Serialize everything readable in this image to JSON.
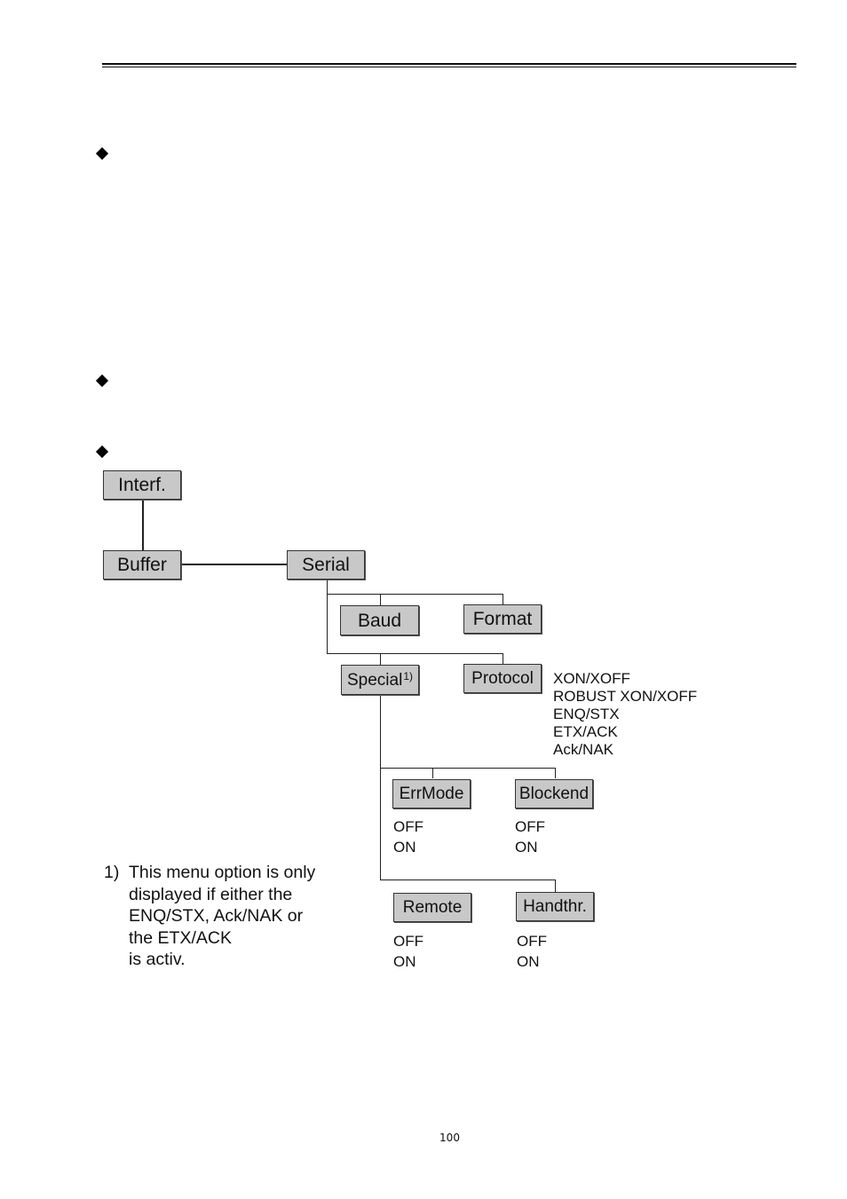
{
  "page": {
    "page_number": "100"
  },
  "diagram": {
    "nodes": {
      "interf": "Interf.",
      "buffer": "Buffer",
      "serial": "Serial",
      "baud": "Baud",
      "format": "Format",
      "special": "Special",
      "special_footnote_mark": "1)",
      "protocol": "Protocol",
      "errmode": "ErrMode",
      "blockend": "Blockend",
      "remote": "Remote",
      "handthr": "Handthr."
    },
    "protocol_options": [
      "XON/XOFF",
      "ROBUST XON/XOFF",
      "ENQ/STX",
      "ETX/ACK",
      "Ack/NAK"
    ],
    "errmode_options": [
      "OFF",
      "ON"
    ],
    "blockend_options": [
      "OFF",
      "ON"
    ],
    "remote_options": [
      "OFF",
      "ON"
    ],
    "handthr_options": [
      "OFF",
      "ON"
    ]
  },
  "footnote": {
    "marker": "1)",
    "lines": [
      "This menu option is only",
      "displayed if either the",
      "ENQ/STX, Ack/NAK or",
      "the ETX/ACK",
      "is activ."
    ]
  }
}
